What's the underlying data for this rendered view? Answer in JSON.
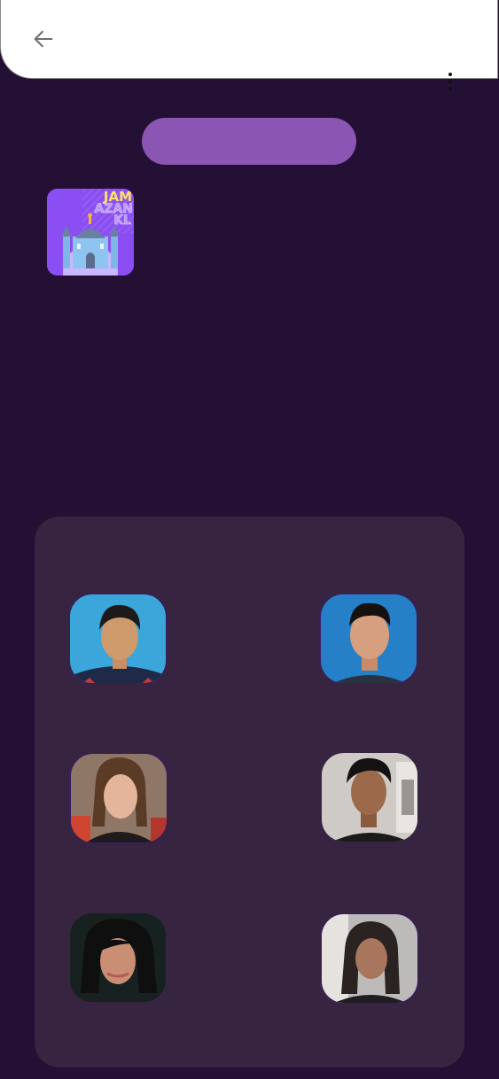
{
  "colors": {
    "background": "#241034",
    "appbar": "#ffffff",
    "pill": "#8a55b3",
    "panel": "#372441",
    "member_border": "#3b1a6a"
  },
  "appbar": {
    "back_icon": "arrow-back-icon",
    "menu_icon": "more-vertical-icon"
  },
  "logo": {
    "line1": "JAM",
    "line2": "AZAN",
    "line3": "KL"
  },
  "team": {
    "members": [
      {
        "photo": "member-1-photo"
      },
      {
        "photo": "member-2-photo"
      },
      {
        "photo": "member-3-photo"
      },
      {
        "photo": "member-4-photo"
      },
      {
        "photo": "member-5-photo"
      },
      {
        "photo": "member-6-photo"
      }
    ]
  }
}
